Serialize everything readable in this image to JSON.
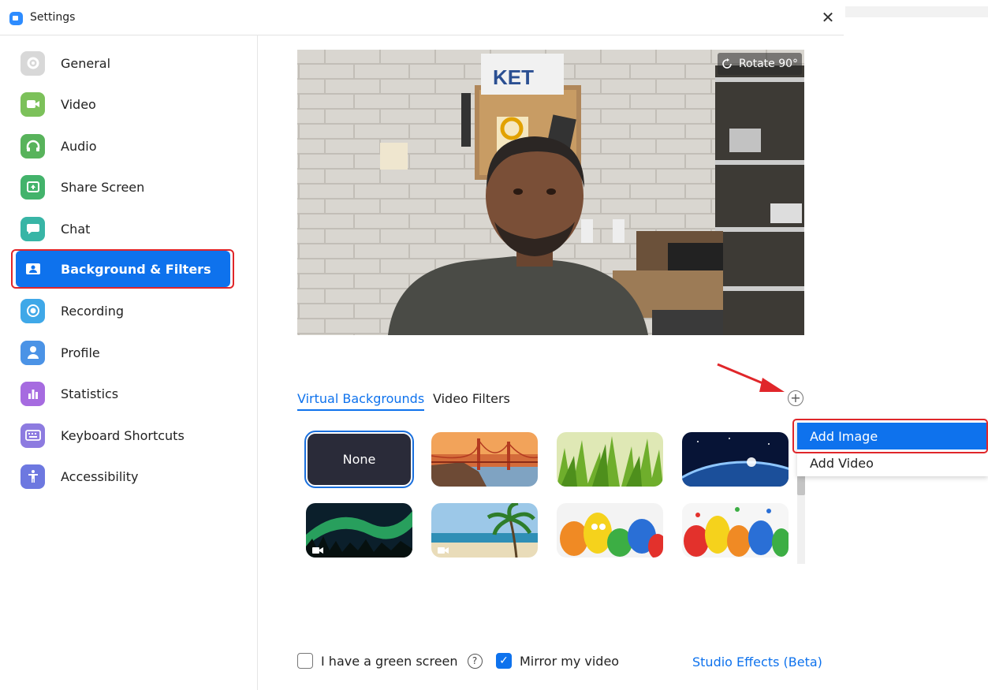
{
  "window": {
    "title": "Settings",
    "close_glyph": "✕"
  },
  "sidebar": {
    "items": [
      {
        "label": "General",
        "icon": "gear-icon",
        "color": "#d7d7d7"
      },
      {
        "label": "Video",
        "icon": "video-camera-icon",
        "color": "#7cc15a"
      },
      {
        "label": "Audio",
        "icon": "headphones-icon",
        "color": "#58b35b"
      },
      {
        "label": "Share Screen",
        "icon": "share-screen-icon",
        "color": "#43b36b"
      },
      {
        "label": "Chat",
        "icon": "chat-bubble-icon",
        "color": "#38b5a6"
      },
      {
        "label": "Background & Filters",
        "icon": "background-icon",
        "color": "#ffffff",
        "active": true
      },
      {
        "label": "Recording",
        "icon": "record-icon",
        "color": "#3fa8e8"
      },
      {
        "label": "Profile",
        "icon": "profile-icon",
        "color": "#4b93e6"
      },
      {
        "label": "Statistics",
        "icon": "statistics-icon",
        "color": "#a66be0"
      },
      {
        "label": "Keyboard Shortcuts",
        "icon": "keyboard-icon",
        "color": "#8d7be0"
      },
      {
        "label": "Accessibility",
        "icon": "accessibility-icon",
        "color": "#6d78e0"
      }
    ]
  },
  "preview": {
    "rotate_label": "Rotate 90°"
  },
  "tabs": [
    {
      "label": "Virtual Backgrounds",
      "active": true
    },
    {
      "label": "Video Filters",
      "active": false
    }
  ],
  "add_button": {
    "glyph": "+"
  },
  "dropdown": {
    "items": [
      "Add Image",
      "Add Video"
    ]
  },
  "backgrounds": [
    {
      "label": "None",
      "kind": "none"
    },
    {
      "kind": "golden-gate"
    },
    {
      "kind": "grass"
    },
    {
      "kind": "earth"
    },
    {
      "kind": "aurora",
      "video": true
    },
    {
      "kind": "beach",
      "video": true
    },
    {
      "kind": "sesame-street-1"
    },
    {
      "kind": "sesame-street-2"
    }
  ],
  "options": {
    "green_screen_label": "I have a green screen",
    "green_screen_checked": false,
    "mirror_label": "Mirror my video",
    "mirror_checked": true,
    "help_glyph": "?",
    "check_glyph": "✓"
  },
  "studio_effects_label": "Studio Effects (Beta)",
  "colors": {
    "accent": "#0e72ed",
    "highlight_outline": "#e0262a"
  }
}
